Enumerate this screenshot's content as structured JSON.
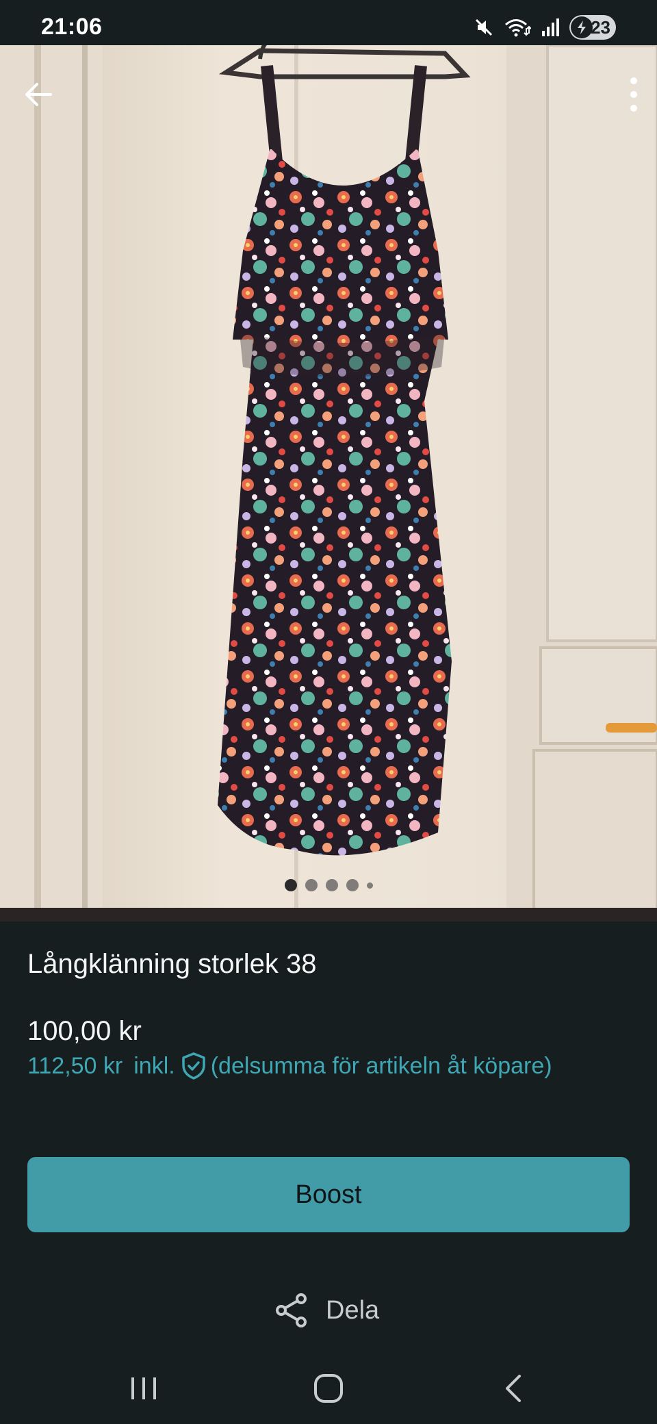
{
  "status_bar": {
    "time": "21:06",
    "icons": [
      "mute-icon",
      "wifi-icon",
      "signal-icon",
      "battery-icon"
    ],
    "battery_level": "23"
  },
  "photo": {
    "description_icons": [
      "back-arrow-icon",
      "more-vert-icon"
    ],
    "page_count": 5,
    "active_page": 1
  },
  "listing": {
    "title": "Långklänning storlek 38",
    "price": "100,00 kr",
    "price_incl_amount": "112,50 kr",
    "price_incl_label": "inkl.",
    "price_incl_note": "(delsumma för artikeln åt köpare)"
  },
  "actions": {
    "boost_label": "Boost",
    "share_label": "Dela"
  },
  "nav_bar": {
    "icons": [
      "recent-apps-icon",
      "home-icon",
      "back-icon"
    ]
  },
  "colors": {
    "background": "#171e20",
    "accent": "#419ca8",
    "accent_text": "#3fa6b3",
    "text": "#f4f6f6"
  }
}
